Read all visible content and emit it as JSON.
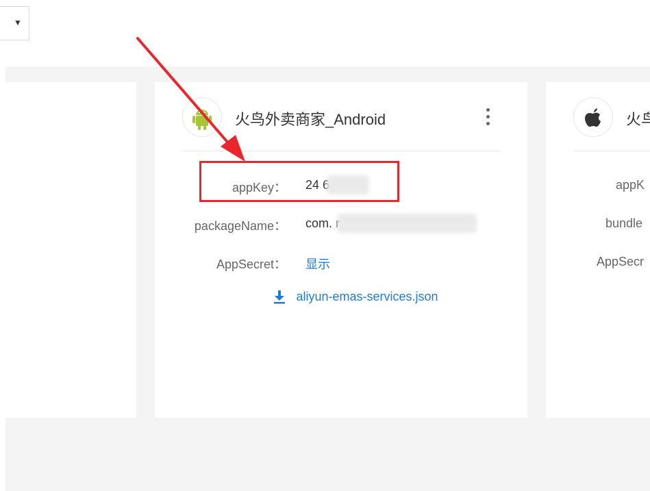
{
  "toolbar": {
    "dropdown_icon": "caret-down-icon"
  },
  "cards": {
    "main": {
      "platform_icon": "android-icon",
      "title": "火鸟外卖商家_Android",
      "menu_icon": "more-vertical-icon",
      "fields": [
        {
          "label": "appKey：",
          "value": "24       6"
        },
        {
          "label": "packageName：",
          "value": "com.                            ness"
        },
        {
          "label": "AppSecret：",
          "value": "显示"
        }
      ],
      "download": {
        "icon": "download-icon",
        "label": "aliyun-emas-services.json"
      }
    },
    "right": {
      "platform_icon": "apple-icon",
      "title": "火鸟",
      "labels": [
        "appK",
        "bundle",
        "AppSecr"
      ]
    }
  },
  "annotation": {
    "highlight_color": "#e8262c",
    "link_color": "#1f7ad6"
  }
}
